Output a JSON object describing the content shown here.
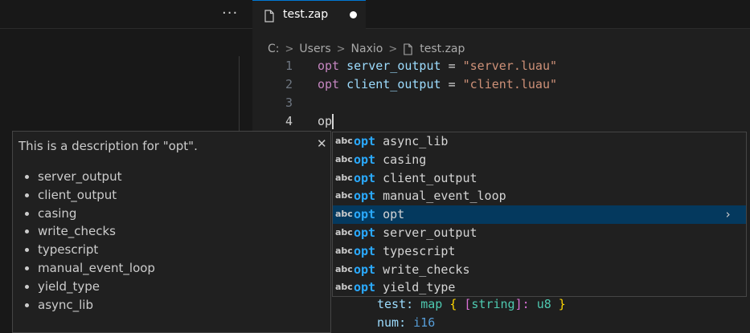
{
  "tabbar": {
    "more_label": "···"
  },
  "tab": {
    "label": "test.zap"
  },
  "breadcrumb": {
    "items": [
      "C:",
      "Users",
      "Naxio",
      "test.zap"
    ],
    "separator": ">"
  },
  "editor": {
    "lines": [
      {
        "number": "1",
        "keyword": "opt",
        "name": "server_output",
        "eq": "=",
        "value": "\"server.luau\""
      },
      {
        "number": "2",
        "keyword": "opt",
        "name": "client_output",
        "eq": "=",
        "value": "\"client.luau\""
      },
      {
        "number": "3"
      },
      {
        "number": "4",
        "typed": "op"
      }
    ],
    "bottom_lines": [
      {
        "name": "test:",
        "t1": "map",
        "b1": "{",
        "b2": "[",
        "t2": "string",
        "b3": "]:",
        "t3": "u8",
        "b4": "}"
      },
      {
        "name": "num:",
        "t1": "i16"
      }
    ]
  },
  "details": {
    "description": "This is a description for \"opt\".",
    "close_label": "✕",
    "items": [
      "server_output",
      "client_output",
      "casing",
      "write_checks",
      "typescript",
      "manual_event_loop",
      "yield_type",
      "async_lib"
    ]
  },
  "suggest": {
    "icon_label": "abc",
    "prefix": "opt",
    "selected_chevron": "›",
    "items": [
      "async_lib",
      "casing",
      "client_output",
      "manual_event_loop",
      "opt",
      "server_output",
      "typescript",
      "write_checks",
      "yield_type"
    ]
  },
  "colors": {
    "accent": "#0078d4",
    "selection": "#04395e",
    "highlight": "#2aaaff"
  }
}
